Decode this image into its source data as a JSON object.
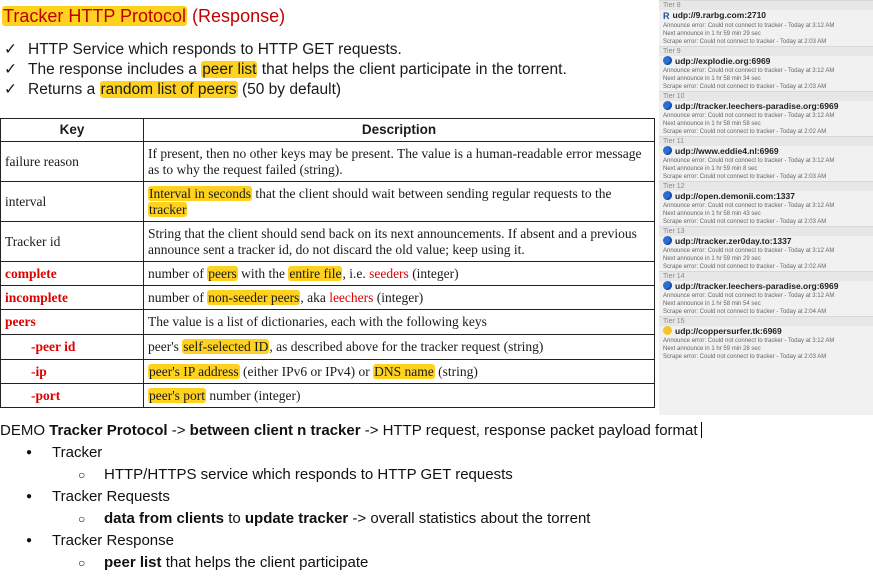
{
  "slide": {
    "title_part1": "Tracker HTTP Protocol",
    "title_part2": " (Response)",
    "bullets": [
      {
        "pre": "HTTP Service which responds to HTTP GET requests.",
        "hl": "",
        "post": ""
      },
      {
        "pre": "The response includes a ",
        "hl": "peer list",
        "post": " that helps the client participate in the torrent."
      },
      {
        "pre": "Returns a ",
        "hl": "random list of peers",
        "post": " (50 by default)"
      }
    ],
    "table": {
      "headers": [
        "Key",
        "Description"
      ],
      "rows": [
        {
          "key": "failure reason",
          "desc": "If present, then no other keys may be present. The value is a human-readable error message as to why the request failed (string)."
        },
        {
          "key": "interval",
          "desc_hl1": "Interval in seconds",
          "desc_mid": " that the client should wait between sending regular requests to the ",
          "desc_hl2": "tracker"
        },
        {
          "key": "Tracker id",
          "desc": "String that the client should send back on its next announcements. If absent and a previous announce sent a tracker id, do not discard the old value; keep using it."
        },
        {
          "key": "complete",
          "p1": "number of ",
          "h1": "peers",
          "p2": " with the ",
          "h2": "entire file",
          "p3": ", i.e. ",
          "r1": "seeders",
          "p4": " (integer)"
        },
        {
          "key": "incomplete",
          "p1": "number of ",
          "h1": "non-seeder peers",
          "p2": ", aka ",
          "r1": "leechers",
          "p3": " (integer)"
        },
        {
          "key": "peers",
          "desc": "The value is a list of dictionaries, each with the following keys"
        },
        {
          "key": "-peer id",
          "p1": "peer's ",
          "h1": "self-selected ID",
          "p2": ", as described above for the tracker request (string)"
        },
        {
          "key": "-ip",
          "h1": "peer's IP address",
          "p1": " (either IPv6 or IPv4) or ",
          "h2": "DNS name",
          "p2": " (string)"
        },
        {
          "key": "-port",
          "h1": "peer's port",
          "p1": " number (integer)"
        }
      ]
    }
  },
  "tracker_panel": {
    "top_tier": "Tier 8",
    "tiers": [
      {
        "tier": "",
        "icon": "rarbg-r-icon",
        "url": "udp://9.rarbg.com:2710",
        "lines": [
          "Announce error: Could not connect to tracker - Today at 3:12 AM",
          "Next announce in 1 hr 59 min 29 sec",
          "Scrape error: Could not connect to tracker - Today at 2:03 AM"
        ]
      },
      {
        "tier": "Tier 9",
        "icon": "globe-icon",
        "url": "udp://explodie.org:6969",
        "lines": [
          "Announce error: Could not connect to tracker - Today at 3:12 AM",
          "Next announce in 1 hr 58 min 34 sec",
          "Scrape error: Could not connect to tracker - Today at 2:03 AM"
        ]
      },
      {
        "tier": "Tier 10",
        "icon": "globe-icon",
        "url": "udp://tracker.leechers-paradise.org:6969",
        "lines": [
          "Announce error: Could not connect to tracker - Today at 3:12 AM",
          "Next announce in 1 hr 58 min 58 sec",
          "Scrape error: Could not connect to tracker - Today at 2:02 AM"
        ]
      },
      {
        "tier": "Tier 11",
        "icon": "globe-icon",
        "url": "udp://www.eddie4.nl:6969",
        "lines": [
          "Announce error: Could not connect to tracker - Today at 3:12 AM",
          "Next announce in 1 hr 59 min 8 sec",
          "Scrape error: Could not connect to tracker - Today at 2:03 AM"
        ]
      },
      {
        "tier": "Tier 12",
        "icon": "globe-icon",
        "url": "udp://open.demonii.com:1337",
        "lines": [
          "Announce error: Could not connect to tracker - Today at 3:12 AM",
          "Next announce in 1 hr 58 min 43 sec",
          "Scrape error: Could not connect to tracker - Today at 2:03 AM"
        ]
      },
      {
        "tier": "Tier 13",
        "icon": "globe-icon",
        "url": "udp://tracker.zer0day.to:1337",
        "lines": [
          "Announce error: Could not connect to tracker - Today at 3:12 AM",
          "Next announce in 1 hr 59 min 29 sec",
          "Scrape error: Could not connect to tracker - Today at 2:02 AM"
        ]
      },
      {
        "tier": "Tier 14",
        "icon": "globe-icon",
        "url": "udp://tracker.leechers-paradise.org:6969",
        "lines": [
          "Announce error: Could not connect to tracker - Today at 3:12 AM",
          "Next announce in 1 hr 58 min 54 sec",
          "Scrape error: Could not connect to tracker - Today at 2:04 AM"
        ]
      },
      {
        "tier": "Tier 15",
        "icon": "yellow-dot-icon",
        "url": "udp://coppersurfer.tk:6969",
        "lines": [
          "Announce error: Could not connect to tracker - Today at 3:12 AM",
          "Next announce in 1 hr 59 min 28 sec",
          "Scrape error: Could not connect to tracker - Today at 2:03 AM"
        ]
      }
    ]
  },
  "notes": {
    "demo": {
      "p1": "DEMO ",
      "b1": "Tracker Protocol",
      "p2": " -> ",
      "b2": "between client n tracker",
      "p3": " -> HTTP request, response packet payload format"
    },
    "items": [
      {
        "text": "Tracker",
        "sub": [
          {
            "b": "",
            "p": "HTTP/HTTPS service which responds to HTTP GET requests"
          }
        ]
      },
      {
        "text": "Tracker Requests",
        "sub": [
          {
            "b": "data from clients",
            "p": " to ",
            "b2": "update tracker",
            "p2": " -> overall statistics about the torrent"
          }
        ]
      },
      {
        "text": "Tracker Response",
        "sub": [
          {
            "b": "peer list",
            "p": " that helps the client participate"
          }
        ]
      }
    ]
  },
  "colors": {
    "highlight": "#ffd21f",
    "title_red": "#c00000",
    "key_red": "#e00000",
    "globe_blue": "#2a6fd6",
    "dot_yellow": "#f3c623",
    "rarbg_blue": "#1f4e99"
  }
}
